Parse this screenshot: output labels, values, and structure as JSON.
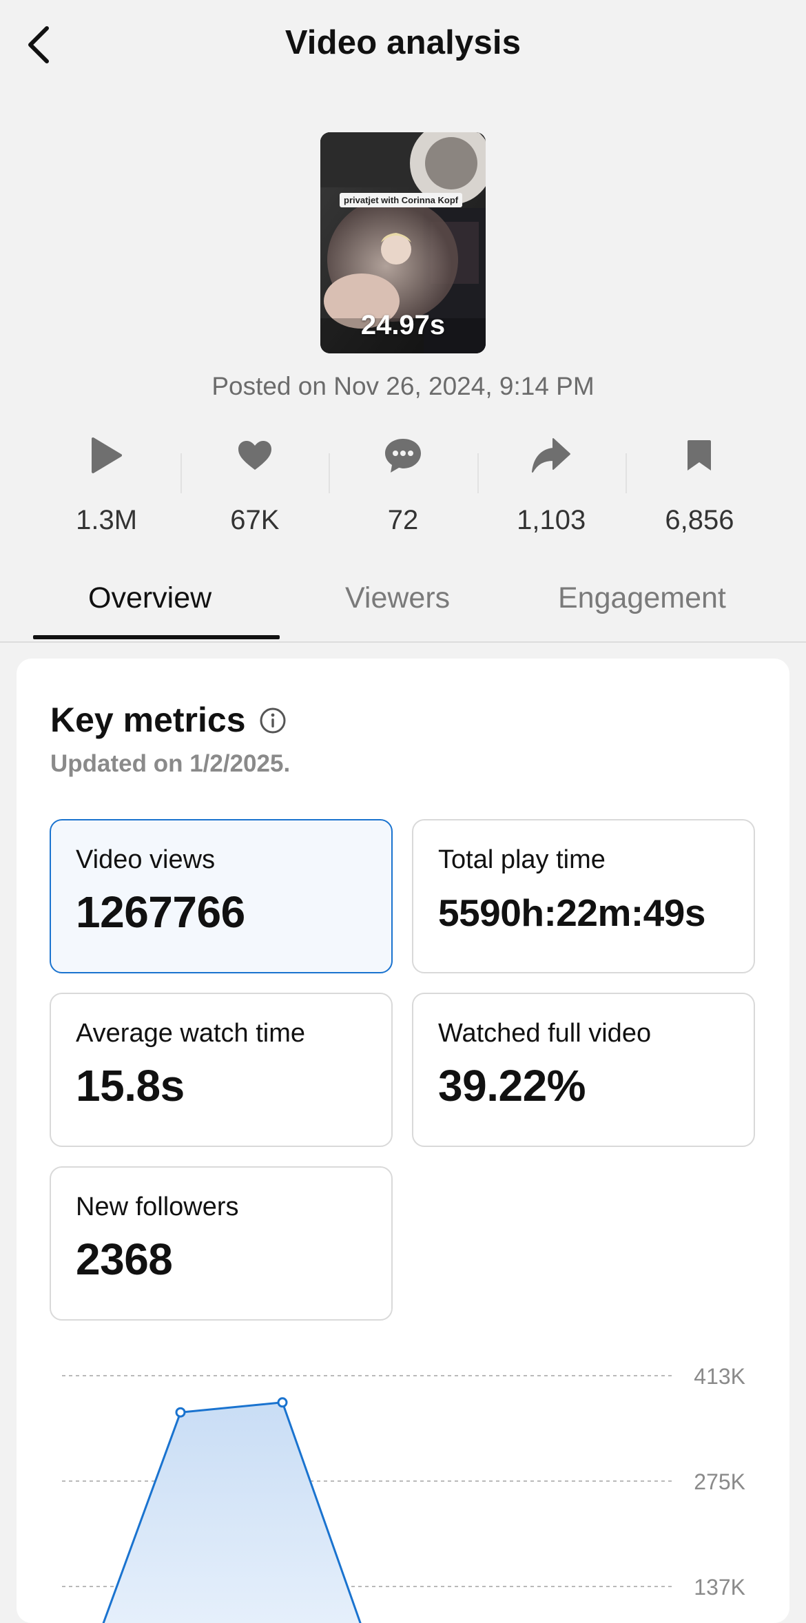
{
  "header": {
    "title": "Video analysis"
  },
  "video": {
    "duration": "24.97s",
    "caption_overlay": "privatjet with Corinna Kopf",
    "posted": "Posted on Nov 26, 2024, 9:14 PM"
  },
  "stats": [
    {
      "icon": "play-icon",
      "value": "1.3M"
    },
    {
      "icon": "heart-icon",
      "value": "67K"
    },
    {
      "icon": "comment-icon",
      "value": "72"
    },
    {
      "icon": "share-icon",
      "value": "1,103"
    },
    {
      "icon": "bookmark-icon",
      "value": "6,856"
    }
  ],
  "tabs": [
    {
      "label": "Overview",
      "active": true
    },
    {
      "label": "Viewers",
      "active": false
    },
    {
      "label": "Engagement",
      "active": false
    }
  ],
  "key_metrics": {
    "title": "Key metrics",
    "updated": "Updated on 1/2/2025.",
    "items": [
      {
        "label": "Video views",
        "value": "1267766",
        "selected": true
      },
      {
        "label": "Total play time",
        "value": "5590h:22m:49s",
        "selected": false
      },
      {
        "label": "Average watch time",
        "value": "15.8s",
        "selected": false
      },
      {
        "label": "Watched full video",
        "value": "39.22%",
        "selected": false
      },
      {
        "label": "New followers",
        "value": "2368",
        "selected": false
      }
    ]
  },
  "colors": {
    "accent": "#1a73cf",
    "fill_top": "#c9ddf5",
    "fill_bottom": "#eef5fd"
  },
  "chart_data": {
    "type": "area",
    "y_ticks": [
      "413K",
      "275K",
      "137K"
    ],
    "y_tick_values": [
      413000,
      275000,
      137000
    ],
    "points": [
      {
        "x": 0,
        "y": 0
      },
      {
        "x": 1,
        "y": 365000
      },
      {
        "x": 2,
        "y": 378000
      },
      {
        "x": 3,
        "y": 0
      }
    ],
    "grid": true
  }
}
